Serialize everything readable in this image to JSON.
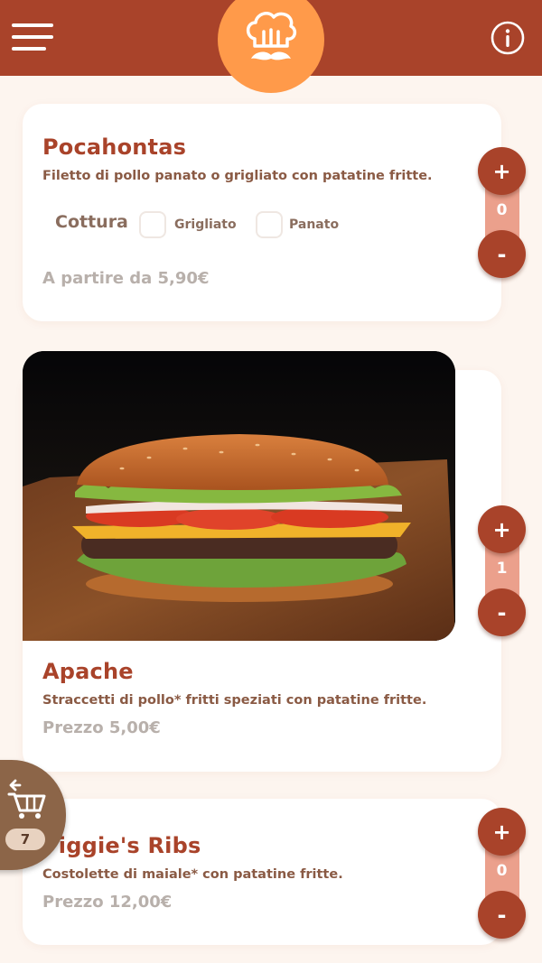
{
  "colors": {
    "header_bg": "#a9432a",
    "logo_bg": "#ff9a4a",
    "page_bg": "#fdf5ef",
    "accent": "#a9432a",
    "stepper_track": "#eba08c",
    "cart_bg": "#8c6548"
  },
  "header": {
    "menu_icon": "hamburger-menu-icon",
    "logo_icon": "chef-hat-mustache-icon",
    "info_icon": "info-icon"
  },
  "products": [
    {
      "title": "Pocahontas",
      "description": "Filetto di pollo panato o grigliato con patatine fritte.",
      "cottura": {
        "label": "Cottura",
        "options": [
          "Grigliato",
          "Panato"
        ]
      },
      "price": "A partire da 5,90€",
      "quantity": "0"
    },
    {
      "title": "Apache",
      "description": "Straccetti di pollo* fritti speziati con patatine fritte.",
      "price": "Prezzo 5,00€",
      "quantity": "1",
      "image_icon": "burger-photo"
    },
    {
      "title": "Piggie's Ribs",
      "description": "Costolette di maiale* con patatine fritte.",
      "price": "Prezzo 12,00€",
      "quantity": "0"
    }
  ],
  "stepper": {
    "plus_label": "+",
    "minus_label": "-"
  },
  "cart": {
    "icon": "cart-return-icon",
    "count": "7"
  }
}
